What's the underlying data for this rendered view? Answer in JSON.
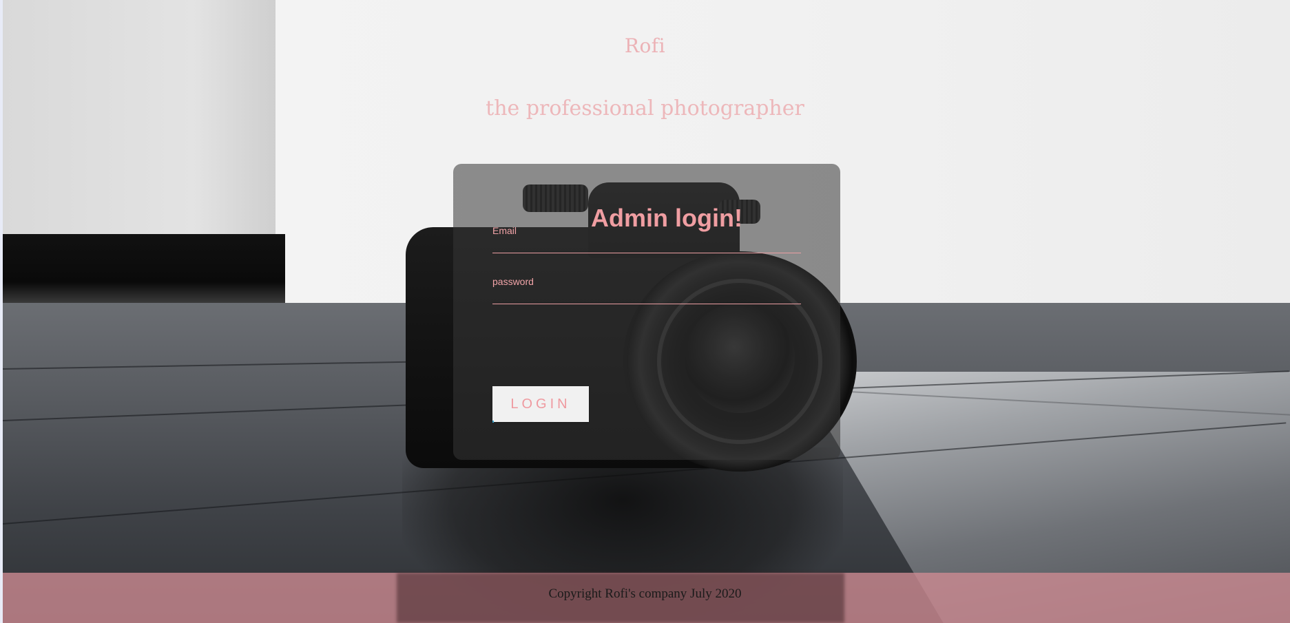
{
  "header": {
    "brand": "Rofi",
    "tagline": "the professional photographer"
  },
  "login_card": {
    "title": "Admin login!",
    "email": {
      "label": "Email",
      "value": "",
      "placeholder": ""
    },
    "password": {
      "label": "password",
      "value": "",
      "placeholder": ""
    },
    "submit_label": "LOGIN"
  },
  "footer": {
    "copyright": "Copyright Rofi's company July 2020"
  },
  "colors": {
    "accent_pink": "#f09ea2",
    "footer_bg": "#d08c93",
    "card_bg": "#373737"
  },
  "background": {
    "image_subject": "camera-photo"
  }
}
